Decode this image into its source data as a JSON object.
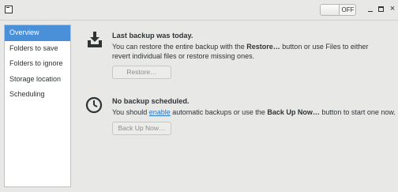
{
  "window": {
    "toggle_label": "OFF",
    "minimize_label": "",
    "close_label": "×"
  },
  "sidebar": {
    "items": [
      {
        "label": "Overview"
      },
      {
        "label": "Folders to save"
      },
      {
        "label": "Folders to ignore"
      },
      {
        "label": "Storage location"
      },
      {
        "label": "Scheduling"
      }
    ]
  },
  "backup": {
    "heading": "Last backup was today.",
    "line1_pre": "You can restore the entire backup with the ",
    "line1_bold": "Restore…",
    "line1_post": " button or use Files to either",
    "line2": "revert individual files or restore missing ones.",
    "button": "Restore…"
  },
  "schedule": {
    "heading": "No backup scheduled.",
    "line_pre": "You should ",
    "line_link": "enable",
    "line_mid": " automatic backups or use the ",
    "line_bold": "Back Up Now…",
    "line_post": " button to start one now.",
    "button": "Back Up Now…"
  },
  "colors": {
    "selection": "#4a90d9",
    "link": "#2a76c6",
    "background": "#e8e8e7"
  }
}
